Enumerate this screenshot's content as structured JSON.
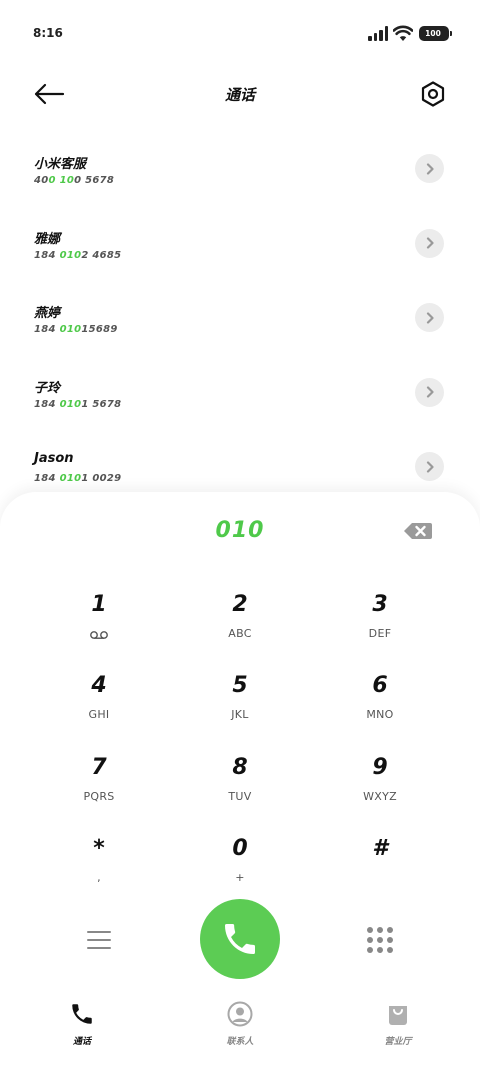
{
  "status_bar": {
    "time": "8:16",
    "battery": "100"
  },
  "header": {
    "title": "通话"
  },
  "contacts": [
    {
      "name": "小米客服",
      "number_pre": "40",
      "number_match": "0 10",
      "number_post": "0 5678"
    },
    {
      "name": "雅娜",
      "number_pre": "184 ",
      "number_match": "010",
      "number_post": "2 4685"
    },
    {
      "name": "燕婷",
      "number_pre": "184 ",
      "number_match": "010",
      "number_post": "15689"
    },
    {
      "name": "子玲",
      "number_pre": "184 ",
      "number_match": "010",
      "number_post": "1 5678"
    },
    {
      "name": "Jason",
      "number_pre": "184 ",
      "number_match": "010",
      "number_post": "1 0029"
    }
  ],
  "dialer": {
    "input": "010",
    "keys": [
      {
        "digit": "1",
        "sub": "",
        "icon": "voicemail-icon"
      },
      {
        "digit": "2",
        "sub": "ABC"
      },
      {
        "digit": "3",
        "sub": "DEF"
      },
      {
        "digit": "4",
        "sub": "GHI"
      },
      {
        "digit": "5",
        "sub": "JKL"
      },
      {
        "digit": "6",
        "sub": "MNO"
      },
      {
        "digit": "7",
        "sub": "PQRS"
      },
      {
        "digit": "8",
        "sub": "TUV"
      },
      {
        "digit": "9",
        "sub": "WXYZ"
      },
      {
        "digit": "*",
        "sub": ","
      },
      {
        "digit": "0",
        "sub": "+"
      },
      {
        "digit": "#",
        "sub": ""
      }
    ]
  },
  "tabs": [
    {
      "label": "通话",
      "icon": "phone-icon",
      "active": true
    },
    {
      "label": "联系人",
      "icon": "person-icon",
      "active": false
    },
    {
      "label": "营业厅",
      "icon": "shopping-bag-icon",
      "active": false
    }
  ],
  "colors": {
    "accent": "#5ccc54",
    "highlight_text": "#4fc94a",
    "chevron_bg": "#ececec"
  }
}
